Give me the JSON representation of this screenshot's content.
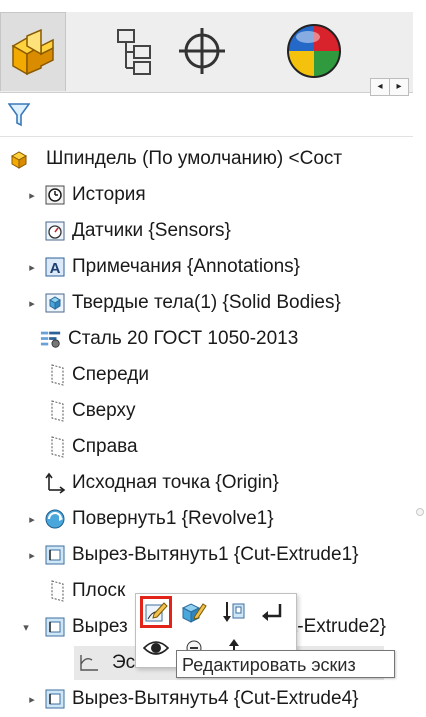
{
  "tree": {
    "root_label": "Шпиндель  (По умолчанию) <Сост",
    "items": [
      {
        "label": "История",
        "icon": "history-icon",
        "expander": true
      },
      {
        "label": "Датчики {Sensors}",
        "icon": "sensor-icon",
        "expander": false
      },
      {
        "label": "Примечания {Annotations}",
        "icon": "annotations-icon",
        "expander": true
      },
      {
        "label": "Твердые тела(1) {Solid Bodies}",
        "icon": "solid-bodies-icon",
        "expander": true
      },
      {
        "label": "Сталь 20 ГОСТ 1050-2013",
        "icon": "material-icon",
        "expander": false
      },
      {
        "label": "Спереди",
        "icon": "plane-icon",
        "expander": false
      },
      {
        "label": "Сверху",
        "icon": "plane-icon",
        "expander": false
      },
      {
        "label": "Справа",
        "icon": "plane-icon",
        "expander": false
      },
      {
        "label": "Исходная точка {Origin}",
        "icon": "origin-icon",
        "expander": false
      },
      {
        "label": "Повернуть1 {Revolve1}",
        "icon": "revolve-icon",
        "expander": true
      },
      {
        "label": "Вырез-Вытянуть1 {Cut-Extrude1}",
        "icon": "cut-extrude-icon",
        "expander": true
      },
      {
        "label": "Плоск",
        "icon": "plane-icon",
        "expander": false
      },
      {
        "label": "Вырез",
        "tail": "t-Extrude2}",
        "icon": "cut-extrude-icon",
        "expander": true,
        "expanded": true
      },
      {
        "label": "Эскиз",
        "icon": "sketch-icon",
        "expander": false
      },
      {
        "label": "Вырез-Вытянуть4 {Cut-Extrude4}",
        "icon": "cut-extrude-icon",
        "expander": true
      }
    ]
  },
  "tabs": [
    {
      "name": "feature-manager",
      "icon": "feature-manager-icon"
    },
    {
      "name": "property-manager",
      "icon": "property-manager-icon"
    },
    {
      "name": "configuration-manager",
      "icon": "configuration-manager-icon"
    },
    {
      "name": "display-manager",
      "icon": "display-manager-icon"
    }
  ],
  "tab_arrows": {
    "left": "◂",
    "right": "▸"
  },
  "context_toolbar": {
    "tooltip": "Редактировать эскиз",
    "buttons": [
      "edit-sketch-icon",
      "edit-feature-icon",
      "rollback-icon",
      "parent-child-icon",
      "show-icon",
      "hide-icon",
      "up-icon"
    ]
  },
  "colors": {
    "highlight": "#e2231a",
    "part_icon": "#f2a900",
    "selection": "#e8e8e8"
  }
}
